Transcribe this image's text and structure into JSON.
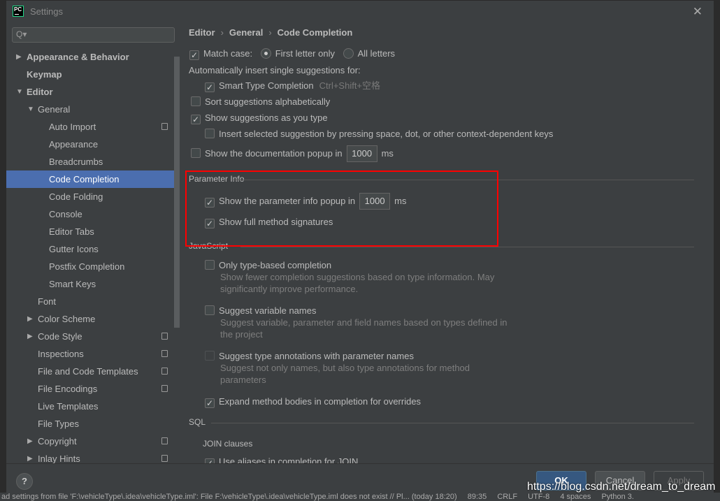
{
  "window": {
    "title": "Settings",
    "logo": "PC"
  },
  "search": {
    "placeholder": "Q▾"
  },
  "tree": [
    {
      "label": "Appearance & Behavior",
      "level": 0,
      "arrow": "▶",
      "bold": true
    },
    {
      "label": "Keymap",
      "level": 0,
      "arrow": "",
      "bold": true
    },
    {
      "label": "Editor",
      "level": 0,
      "arrow": "▼",
      "bold": true
    },
    {
      "label": "General",
      "level": 1,
      "arrow": "▼"
    },
    {
      "label": "Auto Import",
      "level": 2,
      "copy": true
    },
    {
      "label": "Appearance",
      "level": 2
    },
    {
      "label": "Breadcrumbs",
      "level": 2
    },
    {
      "label": "Code Completion",
      "level": 2,
      "selected": true
    },
    {
      "label": "Code Folding",
      "level": 2
    },
    {
      "label": "Console",
      "level": 2
    },
    {
      "label": "Editor Tabs",
      "level": 2
    },
    {
      "label": "Gutter Icons",
      "level": 2
    },
    {
      "label": "Postfix Completion",
      "level": 2
    },
    {
      "label": "Smart Keys",
      "level": 2
    },
    {
      "label": "Font",
      "level": 1
    },
    {
      "label": "Color Scheme",
      "level": 1,
      "arrow": "▶"
    },
    {
      "label": "Code Style",
      "level": 1,
      "arrow": "▶",
      "copy": true
    },
    {
      "label": "Inspections",
      "level": 1,
      "copy": true
    },
    {
      "label": "File and Code Templates",
      "level": 1,
      "copy": true
    },
    {
      "label": "File Encodings",
      "level": 1,
      "copy": true
    },
    {
      "label": "Live Templates",
      "level": 1
    },
    {
      "label": "File Types",
      "level": 1
    },
    {
      "label": "Copyright",
      "level": 1,
      "arrow": "▶",
      "copy": true
    },
    {
      "label": "Inlay Hints",
      "level": 1,
      "arrow": "▶",
      "copy": true
    }
  ],
  "breadcrumb": [
    "Editor",
    "General",
    "Code Completion"
  ],
  "breadcrumb_sep": "›",
  "options": {
    "match_case": {
      "label": "Match case:",
      "checked": true
    },
    "first_letter": {
      "label": "First letter only",
      "selected": true
    },
    "all_letters": {
      "label": "All letters",
      "selected": false
    },
    "auto_insert_header": "Automatically insert single suggestions for:",
    "smart_type": {
      "label": "Smart Type Completion",
      "checked": true,
      "shortcut": "Ctrl+Shift+空格"
    },
    "sort_alpha": {
      "label": "Sort suggestions alphabetically",
      "checked": false
    },
    "show_as_type": {
      "label": "Show suggestions as you type",
      "checked": true
    },
    "insert_selected": {
      "label": "Insert selected suggestion by pressing space, dot, or other context-dependent keys",
      "checked": false
    },
    "doc_popup": {
      "label": "Show the documentation popup in",
      "checked": false,
      "value": "1000",
      "unit": "ms"
    }
  },
  "parameter_info": {
    "title": "Parameter Info",
    "popup": {
      "label": "Show the parameter info popup in",
      "checked": true,
      "value": "1000",
      "unit": "ms"
    },
    "full_sig": {
      "label": "Show full method signatures",
      "checked": true
    }
  },
  "javascript": {
    "title": "JavaScript",
    "type_based": {
      "label": "Only type-based completion",
      "checked": false,
      "desc1": "Show fewer completion suggestions based on type information. May",
      "desc2": "significantly improve performance."
    },
    "var_names": {
      "label": "Suggest variable names",
      "checked": false,
      "desc1": "Suggest variable, parameter and field names based on types defined in",
      "desc2": "the project"
    },
    "type_ann": {
      "label": "Suggest type annotations with parameter names",
      "checked": false,
      "disabled": true,
      "desc1": "Suggest not only names, but also type annotations for method",
      "desc2": "parameters"
    },
    "expand": {
      "label": "Expand method bodies in completion for overrides",
      "checked": true
    }
  },
  "sql": {
    "title": "SQL",
    "join_header": "JOIN clauses",
    "aliases": {
      "label": "Use aliases in completion for JOIN",
      "checked": true
    }
  },
  "buttons": {
    "help": "?",
    "ok": "OK",
    "cancel": "Cancel",
    "apply": "Apply"
  },
  "watermark": "https://blog.csdn.net/dream_to_dream",
  "statusbar": {
    "message": "ad settings from file 'F:\\vehicleType\\.idea\\vehicleType.iml': File F:\\vehicleType\\.idea\\vehicleType.iml does not exist // Pl... (today 18:20)",
    "position": "89:35",
    "line_sep": "CRLF",
    "encoding": "UTF-8",
    "indent": "4 spaces",
    "interpreter": "Python 3."
  },
  "colors": {
    "selection": "#4b6eaf",
    "highlight_box": "#ff0000",
    "ok_button": "#365880"
  }
}
